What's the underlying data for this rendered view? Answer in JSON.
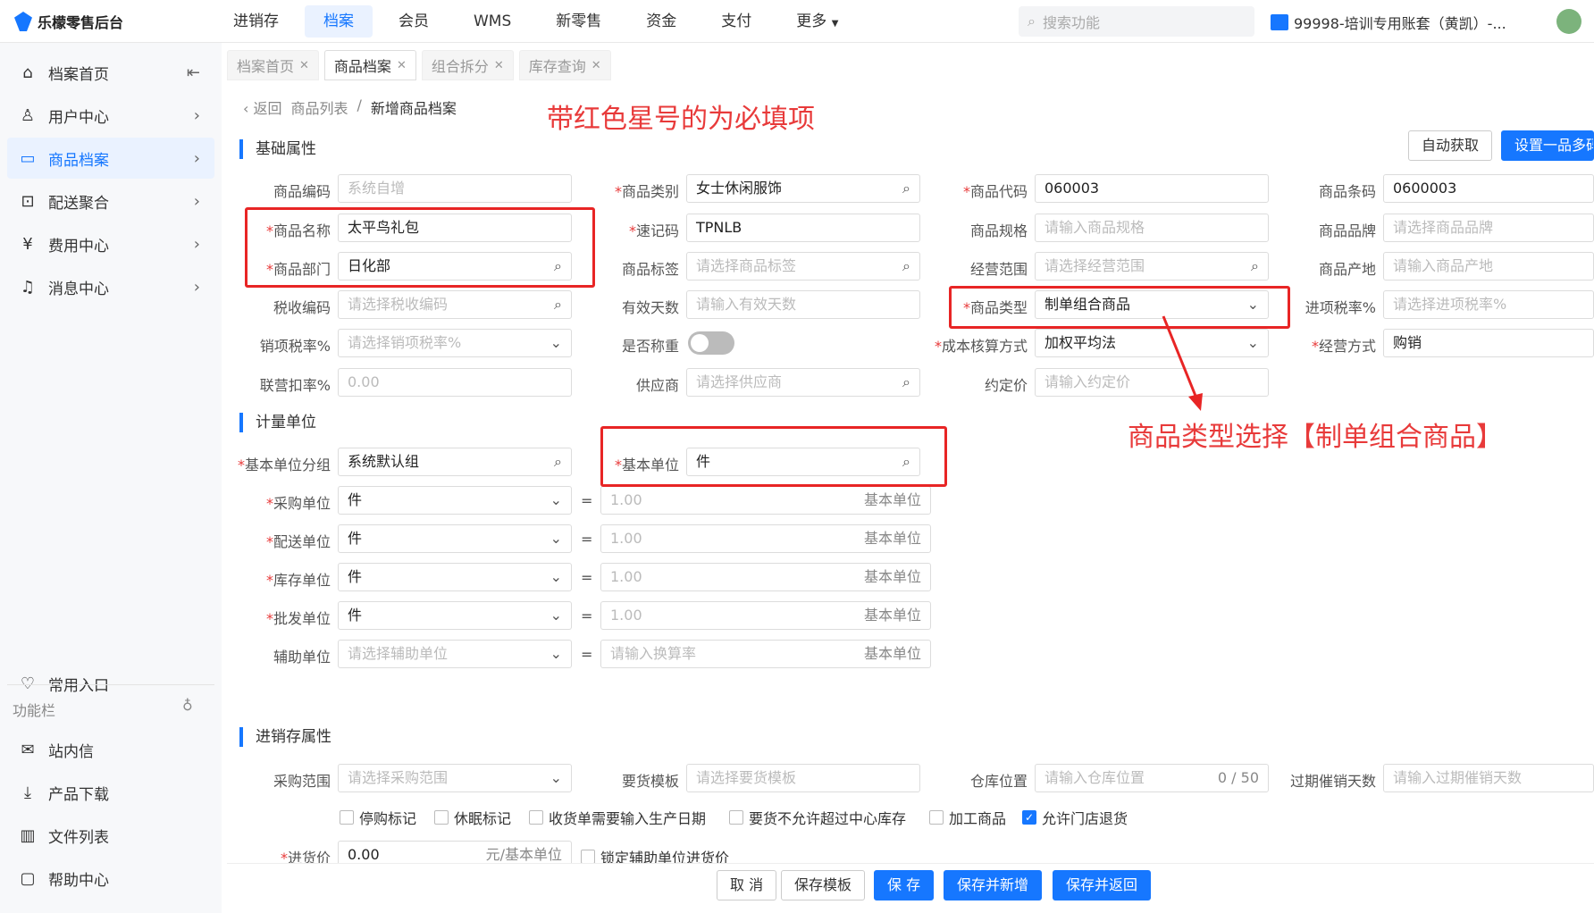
{
  "app": {
    "logo": "乐檬零售后台",
    "search_placeholder": "搜索功能",
    "account": "99998-培训专用账套（黄凯）-...",
    "accent": "#1677ff"
  },
  "nav": [
    "进销存",
    "档案",
    "会员",
    "WMS",
    "新零售",
    "资金",
    "支付",
    "更多"
  ],
  "sidebar": {
    "items": [
      "档案首页",
      "用户中心",
      "商品档案",
      "配送聚合",
      "费用中心",
      "消息中心"
    ],
    "bottom": [
      "常用入口"
    ],
    "section": "功能栏",
    "tools": [
      "站内信",
      "产品下载",
      "文件列表",
      "帮助中心"
    ]
  },
  "tabs": [
    "档案首页",
    "商品档案",
    "组合拆分",
    "库存查询"
  ],
  "crumb": {
    "back": "返回",
    "parent": "商品列表",
    "sep": "/",
    "current": "新增商品档案"
  },
  "annotations": {
    "top": "带红色星号的为必填项",
    "right": "商品类型选择【制单组合商品】",
    "color": "#e83a3a"
  },
  "sections": {
    "basic": "基础属性",
    "unit": "计量单位",
    "inventory": "进销存属性"
  },
  "buttons": {
    "auto": "自动获取",
    "multi": "设置一品多码",
    "cancel": "取 消",
    "save_tpl": "保存模板",
    "save": "保 存",
    "save_new": "保存并新增",
    "save_back": "保存并返回"
  },
  "f": {
    "code_l": "商品编码",
    "code_v": "系统自增",
    "cat_l": "商品类别",
    "cat_v": "女士休闲服饰",
    "gcode_l": "商品代码",
    "gcode_v": "060003",
    "bar_l": "商品条码",
    "bar_v": "0600003",
    "name_l": "商品名称",
    "name_v": "太平鸟礼包",
    "memo_l": "速记码",
    "memo_v": "TPNLB",
    "spec_l": "商品规格",
    "spec_v": "请输入商品规格",
    "brand_l": "商品品牌",
    "brand_v": "请选择商品品牌",
    "dept_l": "商品部门",
    "dept_v": "日化部",
    "tag_l": "商品标签",
    "tag_v": "请选择商品标签",
    "scope_l": "经营范围",
    "scope_v": "请选择经营范围",
    "origin_l": "商品产地",
    "origin_v": "请输入商品产地",
    "tax_l": "税收编码",
    "tax_v": "请选择税收编码",
    "days_l": "有效天数",
    "days_v": "请输入有效天数",
    "type_l": "商品类型",
    "type_v": "制单组合商品",
    "intax_l": "进项税率%",
    "intax_v": "请选择进项税率%",
    "outtax_l": "销项税率%",
    "outtax_v": "请选择销项税率%",
    "weigh_l": "是否称重",
    "cost_l": "成本核算方式",
    "cost_v": "加权平均法",
    "mode_l": "经营方式",
    "mode_v": "购销",
    "joint_l": "联营扣率%",
    "joint_v": "0.00",
    "supplier_l": "供应商",
    "supplier_v": "请选择供应商",
    "price_l": "约定价",
    "price_v": "请输入约定价",
    "group_l": "基本单位分组",
    "group_v": "系统默认组",
    "base_l": "基本单位",
    "base_v": "件",
    "pu_l": "采购单位",
    "pu_v": "件",
    "du_l": "配送单位",
    "du_v": "件",
    "su_l": "库存单位",
    "su_v": "件",
    "wu_l": "批发单位",
    "wu_v": "件",
    "au_l": "辅助单位",
    "au_v": "请选择辅助单位",
    "ratio_v": "1.00",
    "ratio_ph": "请输入换算率",
    "ratio_suf": "基本单位",
    "eq": "=",
    "prange_l": "采购范围",
    "prange_v": "请选择采购范围",
    "tpl_l": "要货模板",
    "tpl_v": "请选择要货模板",
    "loc_l": "仓库位置",
    "loc_v": "请输入仓库位置",
    "loc_count": "0 / 50",
    "exp_l": "过期催销天数",
    "exp_v": "请输入过期催销天数",
    "cb1": "停购标记",
    "cb2": "休眠标记",
    "cb3": "收货单需要输入生产日期",
    "cb4": "要货不允许超过中心库存",
    "cb5": "加工商品",
    "cb6": "允许门店退货",
    "inprice_l": "进货价",
    "inprice_v": "0.00",
    "inprice_suf": "元/基本单位",
    "lock": "锁定辅助单位进货价"
  }
}
